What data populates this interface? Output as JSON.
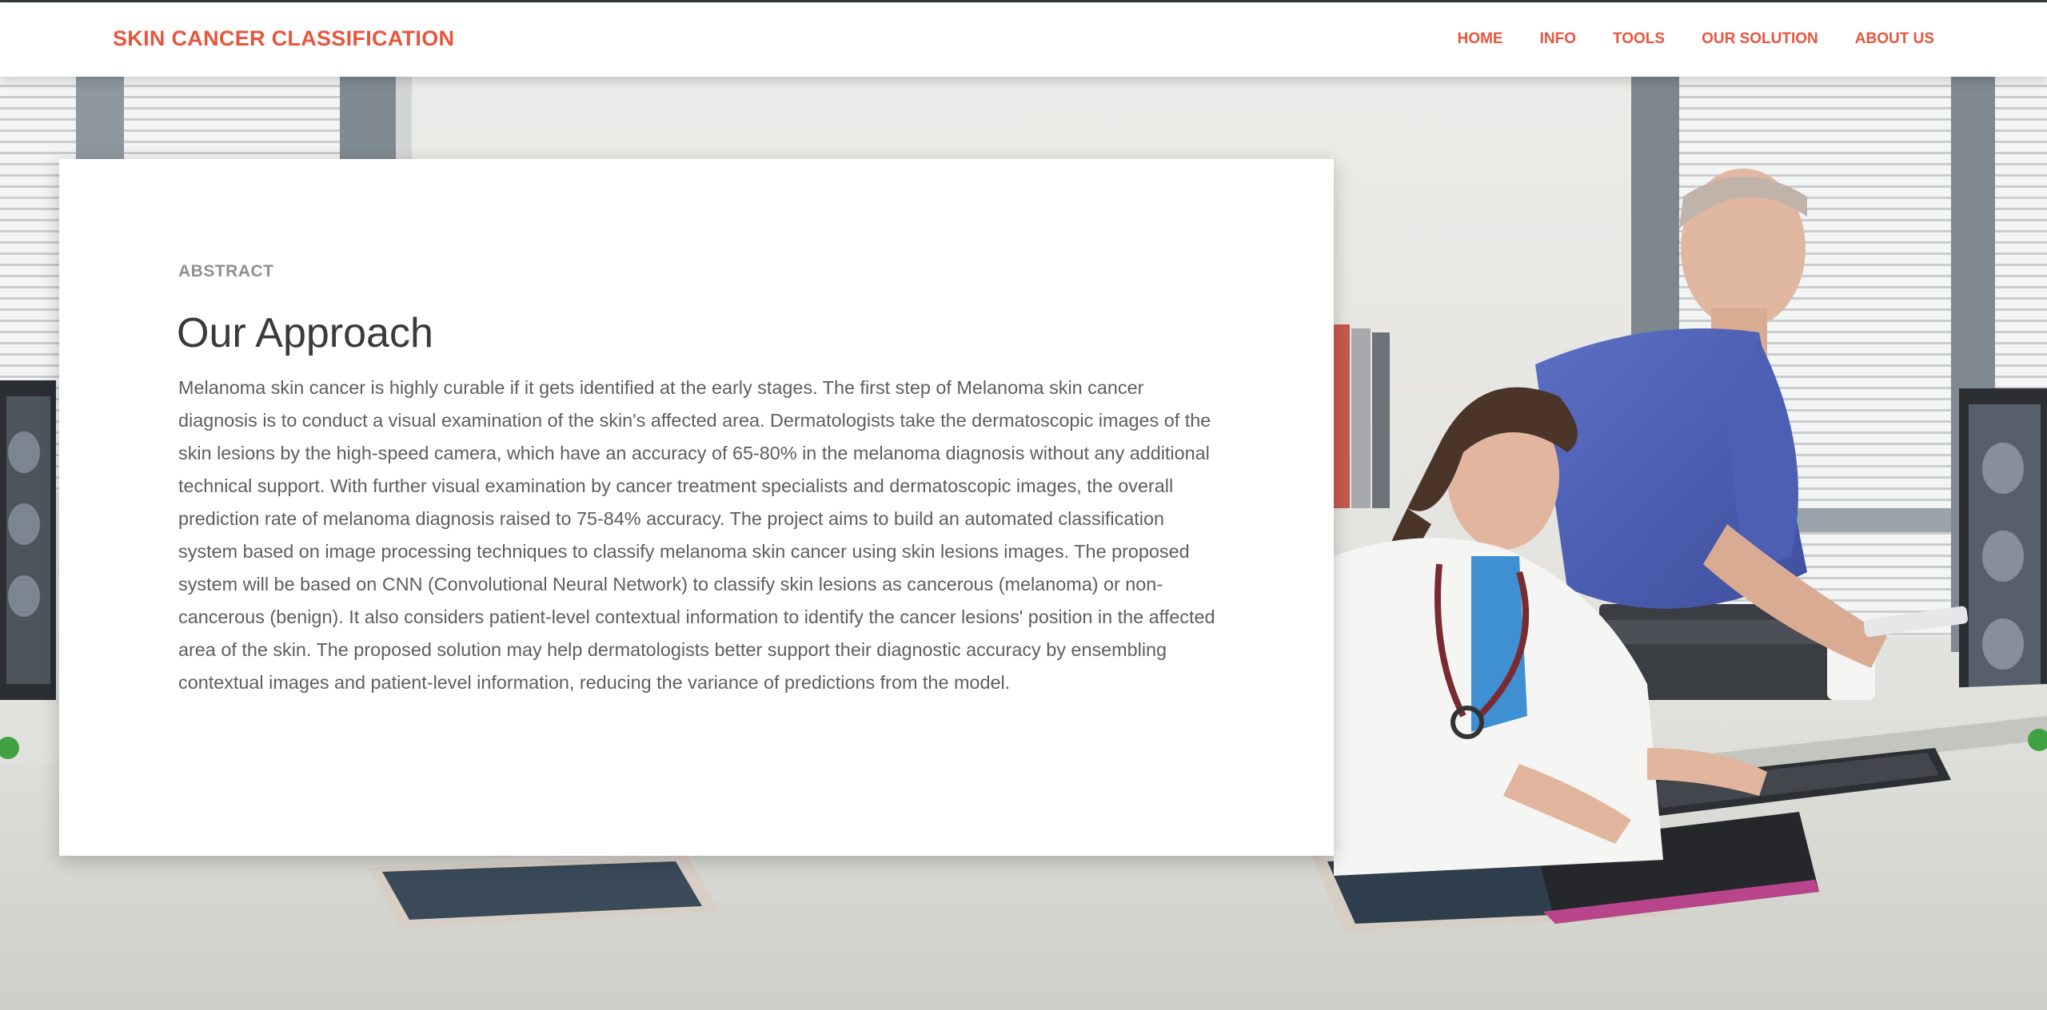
{
  "brand": "SKIN CANCER CLASSIFICATION",
  "nav": {
    "items": [
      "HOME",
      "INFO",
      "TOOLS",
      "OUR SOLUTION",
      "ABOUT US"
    ]
  },
  "abstract": {
    "eyebrow": "ABSTRACT",
    "title": "Our Approach",
    "body": "Melanoma skin cancer is highly curable if it gets identified at the early stages. The first step of Melanoma skin cancer diagnosis is to conduct a visual examination of the skin's affected area. Dermatologists take the dermatoscopic images of the skin lesions by the high-speed camera, which have an accuracy of 65-80% in the melanoma diagnosis without any additional technical support. With further visual examination by cancer treatment specialists and dermatoscopic images, the overall prediction rate of melanoma diagnosis raised to 75-84% accuracy. The project aims to build an automated classification system based on image processing techniques to classify melanoma skin cancer using skin lesions images. The proposed system will be based on CNN (Convolutional Neural Network) to classify skin lesions as cancerous (melanoma) or non-cancerous (benign). It also considers patient-level contextual information to identify the cancer lesions' position in the affected area of the skin. The proposed solution may help dermatologists better support their diagnostic accuracy by ensembling contextual images and patient-level information, reducing the variance of predictions from the model."
  },
  "colors": {
    "accent": "#e8553d",
    "heading": "#3a3a3a",
    "body": "#5e5e5e",
    "eyebrow": "#8f8f8f",
    "topline": "#343a40"
  }
}
